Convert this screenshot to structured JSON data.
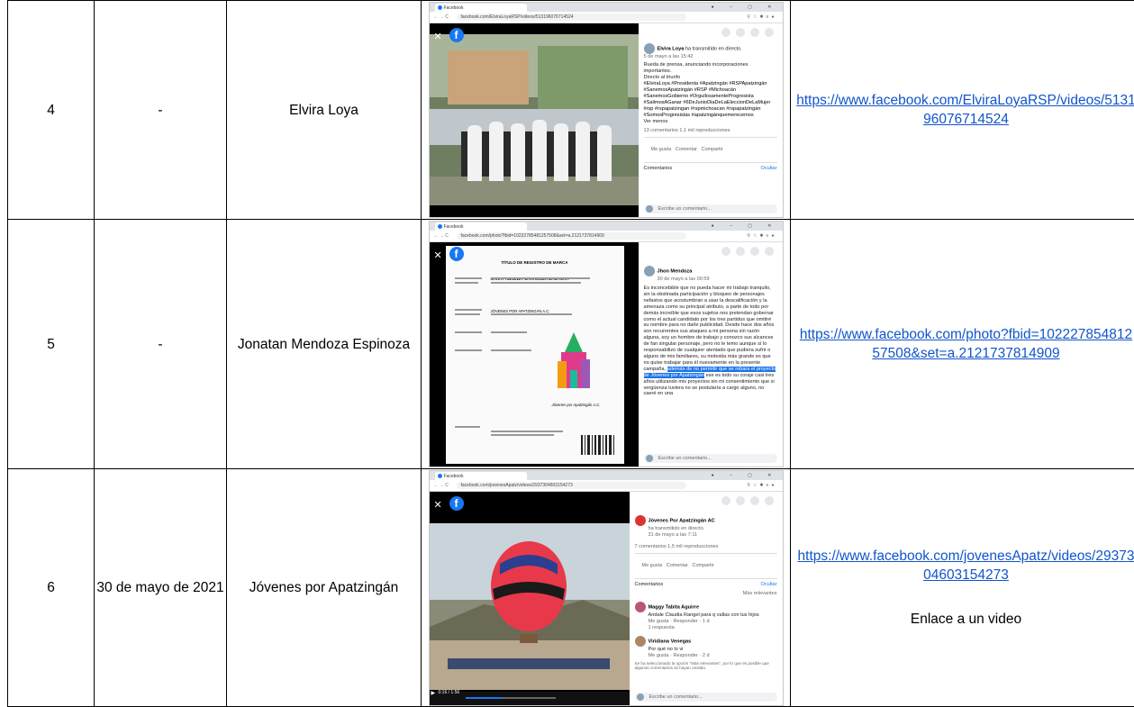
{
  "rows": [
    {
      "num": "4",
      "date": "-",
      "name": "Elvira Loya",
      "link": "https://www.facebook.com/ElviraLoyaRSP/videos/513196076714524",
      "note": "",
      "shot": {
        "tab": "Facebook",
        "address": "facebook.com/ElviraLoyaRSP/videos/513196076714524",
        "author": "Elvira Loya",
        "author_suffix": "ha transmitido en directo.",
        "time": "5 de mayo a las 15:42",
        "text": "Rueda de prensa, anunciando incorporaciones importantes.",
        "text2": "Directo al triunfo",
        "hashtags": "#ElviraLoya #Presidenta #Apatzingán #RSPApatzingán #SanemosApatzingán #RSP #Michoacán #SanemosGobierno #OrgullosamenteProgresista #SalimosAGanar #6DeJunioDiaDeLaEleccionDeLaMujer #rsp #rspapatzingan #rspmichoacan #rspapatzingán #SomosProgresistas #apatzingánquemerecemos",
        "more": "Ver menos",
        "stats": "13 comentarios 1,1 mil reproducciones",
        "like": "Me gusta",
        "comment": "Comentar",
        "share": "Compartir",
        "comments_label": "Comentarios",
        "hide": "Ocultar",
        "write": "Escribe un comentario..."
      }
    },
    {
      "num": "5",
      "date": "-",
      "name": "Jonatan Mendoza Espinoza",
      "link": "https://www.facebook.com/photo?fbid=10222785481257508&set=a.2121737814909",
      "note": "",
      "shot": {
        "tab": "Facebook",
        "address": "facebook.com/photo?fbid=10222785481257508&set=a.2121737814909",
        "author": "Jhon Mendoza",
        "time": "30 de mayo a las 00:59",
        "doc_title": "TÍTULO DE REGISTRO DE MARCA",
        "doc_name": "SARAY ABIGNEY ZARAGOZA BAUTISTA",
        "doc_org": "JÓVENES POR APATZINGÁN A.C.",
        "doc_caption": "Jóvenes por Apatzingán A.C.",
        "post": "Es inconcebible que no pueda hacer mi trabajo tranquilo, sin la obstinada participación y bloqueo de personajes nefastos que acostumbran a usar la descalificación y la amenaza como su principal atributo, a parte de todo por demás increíble que esos sujetos nos pretendan gobernar como el actual candidato por los tres partidos que omitiré su nombre para no darle publicidad. Desde hace dos años son recurrentes sus ataques a mi persona sin razón alguna, soy un hombre de trabajo y conozco sus alcances de fan singular personaje, pero no le temo aunque sí lo responsabilizo de cualquier atentado que pudiera sufrir o alguno de mis familiares, su molestia más grande es que no quise trabajar para él nuevamente en la presente campaña,",
        "highlight": "además de no permitir que se robara el proyecto de Jóvenes por Apatzingán",
        "post_end": "ese es todo su coraje casi tres años utilizando mis proyectos sin mi consentimiento que si vergüenza tuviera no se postularía a cargo alguno, no caeré en una",
        "write": "Escribe un comentario..."
      }
    },
    {
      "num": "6",
      "date": "30 de mayo de 2021",
      "name": "Jóvenes por Apatzingán",
      "link": "https://www.facebook.com/jovenesApatz/videos/2937304603154273",
      "note": "Enlace a un video",
      "shot": {
        "tab": "Facebook",
        "address": "facebook.com/jovenesApatz/videos/2937304603154273",
        "author": "Jóvenes Por Apatzingán AC",
        "author_suffix": "ha transmitido en directo.",
        "time": "31 de mayo a las 7:11",
        "stats": "7 comentarios 1,5 mil reproducciones",
        "like": "Me gusta",
        "comment": "Comentar",
        "share": "Compartir",
        "comments_label": "Comentarios",
        "hide": "Ocultar",
        "sort": "Más relevantes",
        "c1_author": "Maggy Tabita Aguirre",
        "c1_text": "Andale Claudia Rangel para q vallas con tus hijos",
        "c1_actions": "Me gusta · Responder · 1 d",
        "c1_replies": "1 respuesta",
        "c2_author": "Viridiana Venegas",
        "c2_text": "Por qué no lo vi",
        "c2_actions": "Me gusta · Responder · 2 d",
        "filter_note": "Se ha seleccionado la opción \"Más relevantes\", por lo que es posible que algunos comentarios se hayan omitido.",
        "time_code": "0:16 / 1:56",
        "write": "Escribe un comentario..."
      }
    }
  ]
}
